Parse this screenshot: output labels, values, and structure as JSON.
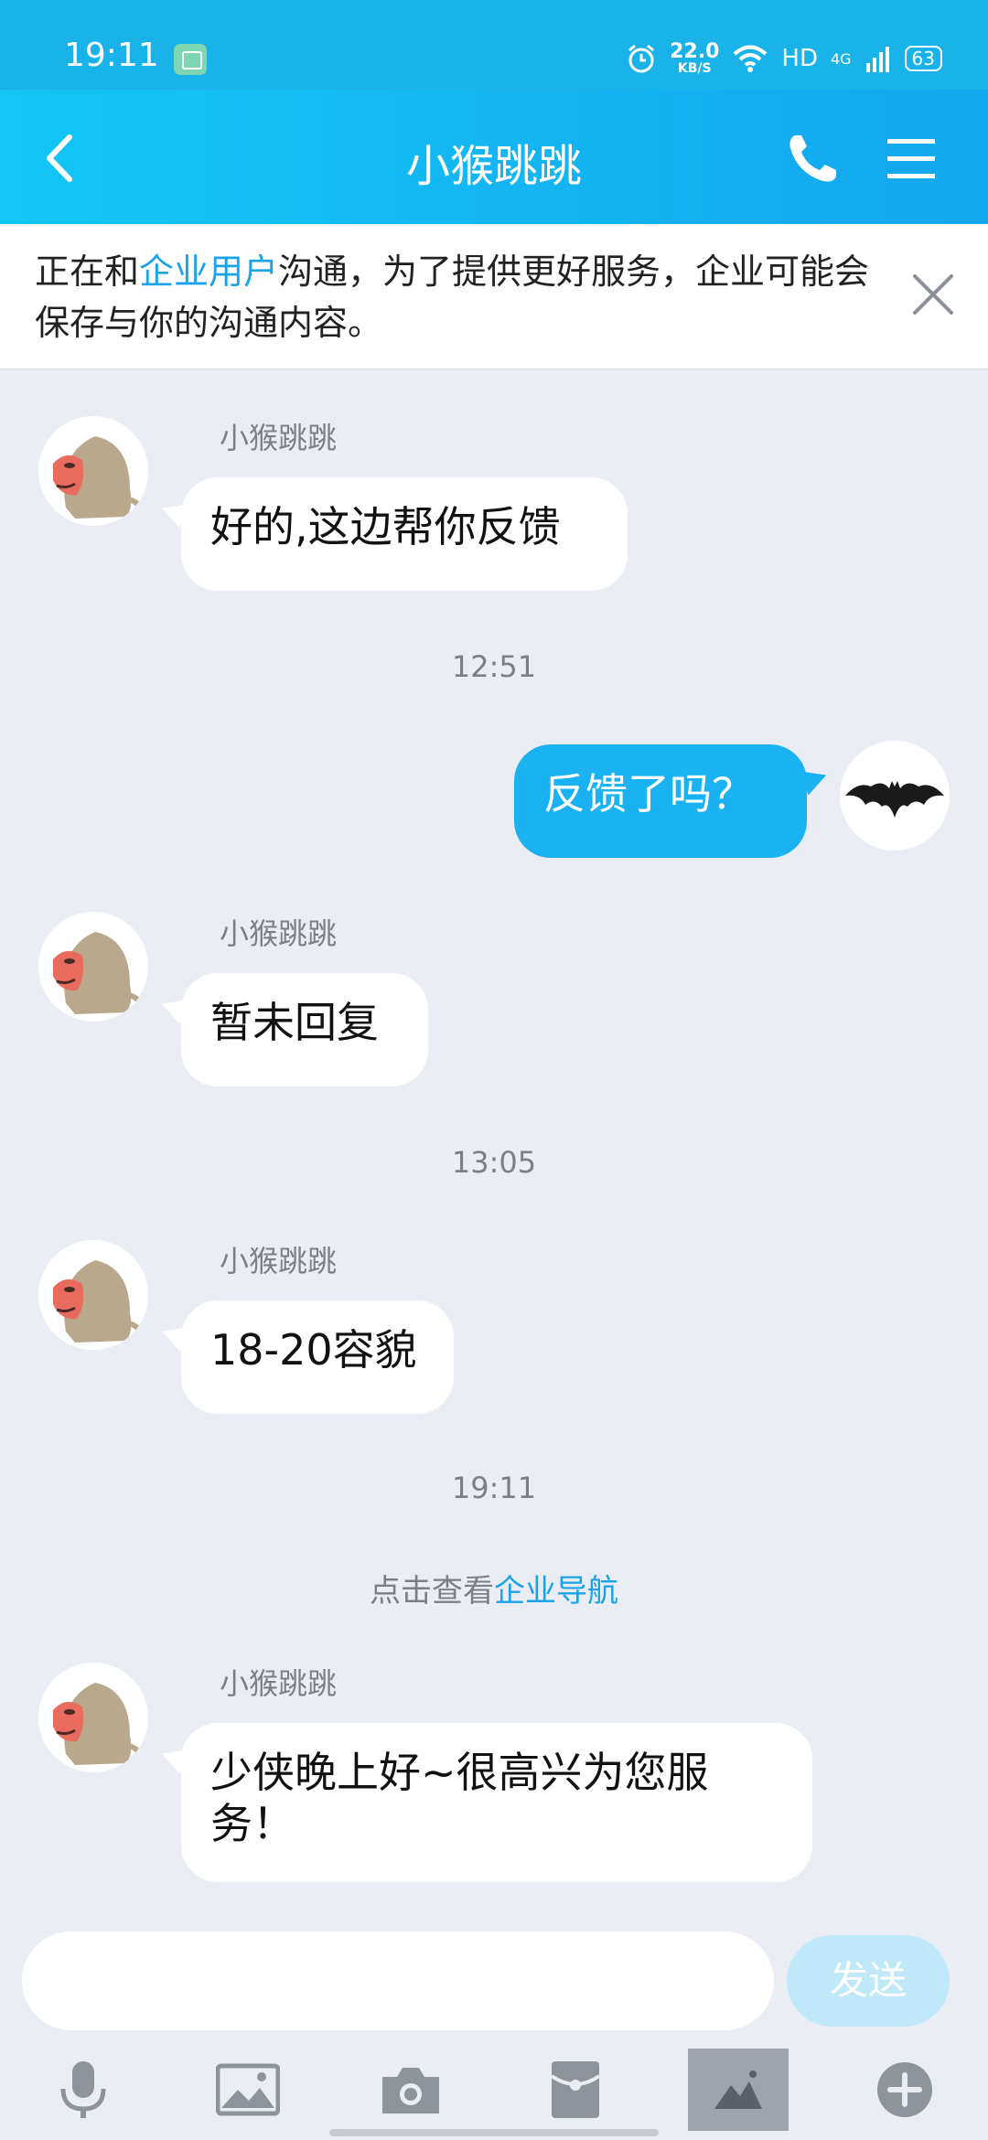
{
  "status_bar": {
    "time": "19:11",
    "net_speed_value": "22.0",
    "net_speed_unit": "KB/S",
    "network_type": "HD",
    "cell": "4G",
    "battery": "63"
  },
  "header": {
    "title": "小猴跳跳"
  },
  "notice": {
    "text_before": "正在和",
    "highlight": "企业用户",
    "text_after": "沟通，为了提供更好服务，企业可能会保存与你的沟通内容。"
  },
  "messages": [
    {
      "sender": "小猴跳跳",
      "text": "好的,这边帮你反馈"
    },
    {
      "time": "12:51"
    },
    {
      "text": "反馈了吗？"
    },
    {
      "sender": "小猴跳跳",
      "text": "暂未回复"
    },
    {
      "time": "13:05"
    },
    {
      "sender": "小猴跳跳",
      "text": "18-20容貌"
    },
    {
      "time": "19:11"
    },
    {
      "sender": "小猴跳跳",
      "text": "少侠晚上好~很高兴为您服务！"
    }
  ],
  "sys_link": {
    "prefix": "点击查看",
    "link": "企业导航"
  },
  "input": {
    "send_label": "发送"
  },
  "colors": {
    "accent": "#1ab2f3",
    "background": "#eaedf4",
    "link": "#1aa3ea"
  }
}
